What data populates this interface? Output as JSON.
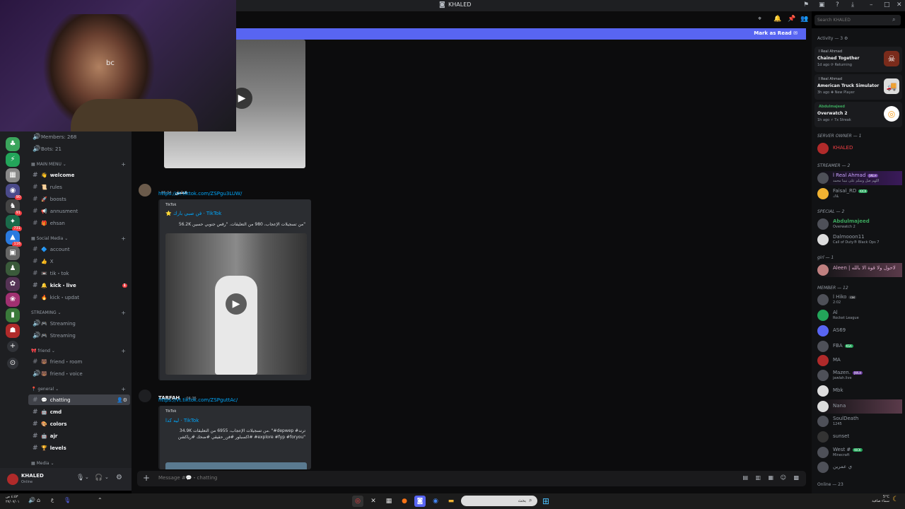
{
  "titlebar": {
    "title": "KHALED"
  },
  "webcam": {
    "overlay_text": "bc"
  },
  "server_badges": [
    "",
    "",
    "",
    "",
    "90",
    "91",
    "731",
    "116",
    "",
    "",
    "",
    "",
    "",
    ""
  ],
  "channels": {
    "stats": [
      "Members: 268",
      "Bots: 21"
    ],
    "cat_main": "MAIN MENU",
    "cat_social": "Social Media",
    "cat_streaming": "STREAMING",
    "cat_friend": "friend",
    "cat_general": "general",
    "cat_media": "Media",
    "main_items": [
      {
        "emoji": "👋",
        "label": "welcome"
      },
      {
        "emoji": "📜",
        "label": "rules"
      },
      {
        "emoji": "🚀",
        "label": "boosts"
      },
      {
        "emoji": "📢",
        "label": "annusment"
      },
      {
        "emoji": "🎁",
        "label": "ehsan"
      }
    ],
    "social_items": [
      {
        "emoji": "🔷",
        "label": "account"
      },
      {
        "emoji": "👍",
        "label": "X"
      },
      {
        "emoji": "📼",
        "label": "tik・tok"
      },
      {
        "emoji": "🔔",
        "label": "kick・live",
        "badge": "1"
      },
      {
        "emoji": "🔥",
        "label": "kick・updat"
      }
    ],
    "streaming_items": [
      {
        "emoji": "🎮",
        "label": "Streaming"
      },
      {
        "emoji": "🎮",
        "label": "Streaming"
      }
    ],
    "friend_items": [
      {
        "emoji": "🐻",
        "label": "friend・room"
      },
      {
        "emoji": "🐻",
        "label": "friend・voice"
      }
    ],
    "general_items": [
      {
        "emoji": "💬",
        "label": "chatting"
      },
      {
        "emoji": "🤖",
        "label": "cmd"
      },
      {
        "emoji": "🎨",
        "label": "colors"
      },
      {
        "emoji": "🤖",
        "label": "ajr"
      },
      {
        "emoji": "🏆",
        "label": "levels"
      }
    ]
  },
  "user": {
    "name": "KHALED",
    "status": "Online"
  },
  "banner": {
    "mark_read": "Mark as Read"
  },
  "messages": [
    {
      "author": "عشق",
      "time": "06:34",
      "link": "https://vt.tiktok.com/ZSPgu3LUW/",
      "provider": "TikTok",
      "title": "فن صبي بارك · TikTok",
      "desc": "56.2K من تسجيلات الإعجاب، 980 من التعليقات. \"رقص جنوبي حسين\""
    },
    {
      "author": "TARFAH",
      "time": "06:35",
      "link": "https://vt.tiktok.com/ZSPguttAc/",
      "provider": "TikTok",
      "title": "ليه كذا · TikTok",
      "desc": "34.9K من تسجيلات الإعجاب، 6955 من التعليقات. \"#depwep #ترند #اكسبلور #فن_حقيقي #ضحك #رياكشن #explore #fyp #foryou\""
    }
  ],
  "composer": {
    "placeholder": "Message #💬・chatting"
  },
  "search": {
    "placeholder": "Search KHALED"
  },
  "activity": {
    "header": "Activity — 3",
    "items": [
      {
        "user": "l Real Ahmad",
        "game": "Chained Together",
        "meta": "1d ago  ⟳ Returning"
      },
      {
        "user": "l Real Ahmad",
        "game": "American Truck Simulator",
        "meta": "3h ago  ✚ New Player"
      },
      {
        "user": "Abdulmajeed",
        "game": "Overwatch 2",
        "meta": "1h ago  ⚡ 7x Streak"
      }
    ]
  },
  "members": {
    "owner_header": "SERVER OWNER — 1",
    "owner": {
      "name": "KHALED"
    },
    "streamer_header": "STREAMER — 2",
    "streamers": [
      {
        "name": "l Real Ahmad",
        "tag": "JWLH",
        "status": "اللهم صل وسلم على نبينا محمد"
      },
      {
        "name": "Faisal_RD",
        "tag": "KICK",
        "status": "بلاك"
      }
    ],
    "special_header": "SPECIAL — 2",
    "special": [
      {
        "name": "Abdulmajeed",
        "status": "Overwatch 2"
      },
      {
        "name": "Dalmooon11",
        "status": "Call of Duty® Black Ops 7"
      }
    ],
    "girl_header": "girl — 1",
    "girl": [
      {
        "name": "Aleen | لاحول ولا قوة الا بالله",
        "status": ""
      }
    ],
    "member_header": "MEMBER — 12",
    "member": [
      {
        "name": "l Hiko",
        "tag": "cas",
        "status": "2:02"
      },
      {
        "name": "Al",
        "status": "Rocket League"
      },
      {
        "name": "AS69",
        "status": ""
      },
      {
        "name": "FBA",
        "tag": "KSA",
        "status": ""
      },
      {
        "name": "MA",
        "status": ""
      },
      {
        "name": "Mazen.",
        "tag": "JWLH",
        "status": "jawlah.live"
      },
      {
        "name": "Mbk",
        "status": ""
      },
      {
        "name": "Nana",
        "status": ""
      },
      {
        "name": "SoulDeath",
        "status": "1245"
      },
      {
        "name": "sunset",
        "status": ""
      },
      {
        "name": "West #",
        "tag": "KICK",
        "status": "Minecraft"
      },
      {
        "name": "ي عمرين",
        "status": ""
      }
    ],
    "online_header": "Online — 23"
  },
  "taskbar": {
    "clock": "٤:٥٣ ص\n٢٧/٠٧/٠١",
    "weather": "5°C",
    "weather_desc": "سماء صافية",
    "search_placeholder": "بحث",
    "lang": "ع"
  }
}
